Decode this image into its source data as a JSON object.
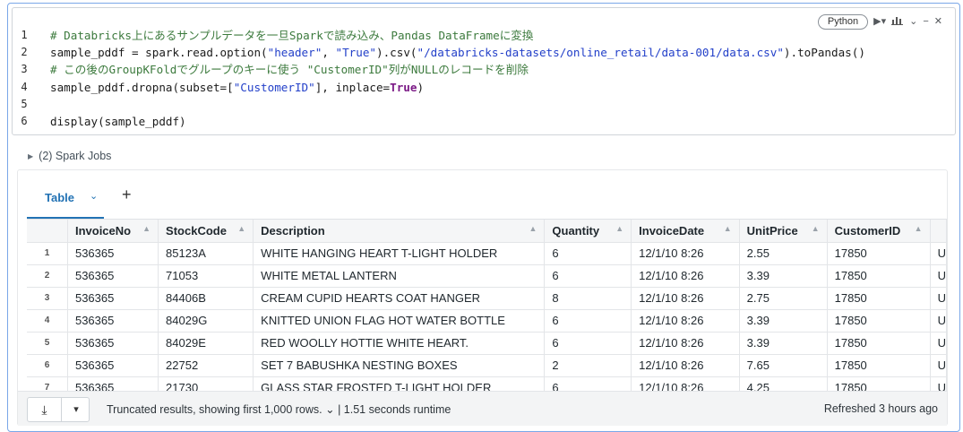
{
  "editor": {
    "language": "Python",
    "toolbar_icons": [
      "run-icon",
      "chart-icon",
      "collapse-icon",
      "minimize-icon",
      "close-icon"
    ],
    "line_numbers": [
      "1",
      "2",
      "3",
      "4",
      "5",
      "6"
    ],
    "lines": [
      [
        {
          "t": "com",
          "v": "# Databricks上にあるサンプルデータを一旦Sparkで読み込み、Pandas DataFrameに変換"
        }
      ],
      [
        {
          "t": "txt",
          "v": "sample_pddf = spark.read.option("
        },
        {
          "t": "str",
          "v": "\"header\""
        },
        {
          "t": "txt",
          "v": ", "
        },
        {
          "t": "str",
          "v": "\"True\""
        },
        {
          "t": "txt",
          "v": ").csv("
        },
        {
          "t": "str",
          "v": "\"/databricks-datasets/online_retail/data-001/data.csv\""
        },
        {
          "t": "txt",
          "v": ").toPandas()"
        }
      ],
      [
        {
          "t": "com",
          "v": "# この後のGroupKFoldでグループのキーに使う \"CustomerID\"列がNULLのレコードを削除"
        }
      ],
      [
        {
          "t": "txt",
          "v": "sample_pddf.dropna(subset=["
        },
        {
          "t": "str",
          "v": "\"CustomerID\""
        },
        {
          "t": "txt",
          "v": "], inplace="
        },
        {
          "t": "kw",
          "v": "True"
        },
        {
          "t": "txt",
          "v": ")"
        }
      ],
      [],
      [
        {
          "t": "txt",
          "v": "display(sample_pddf)"
        }
      ]
    ]
  },
  "jobs": {
    "label": "(2) Spark Jobs"
  },
  "results": {
    "tab_label": "Table",
    "columns": [
      "InvoiceNo",
      "StockCode",
      "Description",
      "Quantity",
      "InvoiceDate",
      "UnitPrice",
      "CustomerID",
      ""
    ],
    "rows": [
      {
        "idx": "1",
        "cells": [
          "536365",
          "85123A",
          "WHITE HANGING HEART T-LIGHT HOLDER",
          "6",
          "12/1/10 8:26",
          "2.55",
          "17850",
          "U"
        ]
      },
      {
        "idx": "2",
        "cells": [
          "536365",
          "71053",
          "WHITE METAL LANTERN",
          "6",
          "12/1/10 8:26",
          "3.39",
          "17850",
          "U"
        ]
      },
      {
        "idx": "3",
        "cells": [
          "536365",
          "84406B",
          "CREAM CUPID HEARTS COAT HANGER",
          "8",
          "12/1/10 8:26",
          "2.75",
          "17850",
          "U"
        ]
      },
      {
        "idx": "4",
        "cells": [
          "536365",
          "84029G",
          "KNITTED UNION FLAG HOT WATER BOTTLE",
          "6",
          "12/1/10 8:26",
          "3.39",
          "17850",
          "U"
        ]
      },
      {
        "idx": "5",
        "cells": [
          "536365",
          "84029E",
          "RED WOOLLY HOTTIE WHITE HEART.",
          "6",
          "12/1/10 8:26",
          "3.39",
          "17850",
          "U"
        ]
      },
      {
        "idx": "6",
        "cells": [
          "536365",
          "22752",
          "SET 7 BABUSHKA NESTING BOXES",
          "2",
          "12/1/10 8:26",
          "7.65",
          "17850",
          "U"
        ]
      },
      {
        "idx": "7",
        "cells": [
          "536365",
          "21730",
          "GLASS STAR FROSTED T-LIGHT HOLDER",
          "6",
          "12/1/10 8:26",
          "4.25",
          "17850",
          "U"
        ]
      }
    ],
    "footer": {
      "truncated": "Truncated results, showing first 1,000 rows.",
      "runtime": "1.51 seconds runtime",
      "refreshed": "Refreshed 3 hours ago"
    }
  },
  "colors": {
    "accent": "#2272b4",
    "cell_border": "#7aa7e8",
    "comment": "#3c7a3d",
    "string": "#2340c9",
    "keyword": "#7b1a86"
  }
}
